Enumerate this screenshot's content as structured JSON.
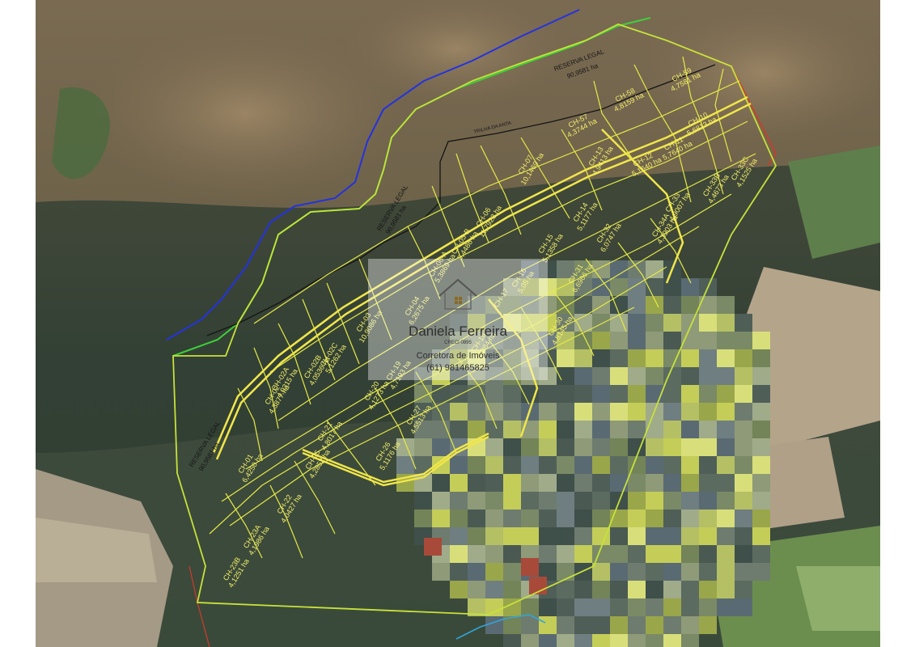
{
  "map": {
    "reserve_labels": [
      "RESERVA LEGAL",
      "90,9581 ha"
    ],
    "trail_labels": [
      "TRILHA DA ANTA"
    ],
    "lots": [
      {
        "id": "CH-59",
        "area": "4,7581 ha"
      },
      {
        "id": "CH-58",
        "area": "4,8159 ha"
      },
      {
        "id": "CH-57",
        "area": "4,3744 ha"
      },
      {
        "id": "CH-10",
        "area": "5,6813 ha"
      },
      {
        "id": "CH-11",
        "area": "5,7640 ha"
      },
      {
        "id": "CH-12",
        "area": "5,1640 ha"
      },
      {
        "id": "CH-13",
        "area": "4,9413 ha"
      },
      {
        "id": "CH-07",
        "area": "10,1469 ha"
      },
      {
        "id": "CH-06",
        "area": "11,7923 ha"
      },
      {
        "id": "CH-05-B",
        "area": "5,4486 ha"
      },
      {
        "id": "CH-06-A",
        "area": "5,3869 ha"
      },
      {
        "id": "CH-14",
        "area": "5,1177 ha"
      },
      {
        "id": "CH-15",
        "area": "5,1358 ha"
      },
      {
        "id": "CH-16",
        "area": "5,05 ha"
      },
      {
        "id": "CH-17",
        "area": ""
      },
      {
        "id": "CH-04",
        "area": "6,2675 ha"
      },
      {
        "id": "CH-03",
        "area": "10,9086 ha"
      },
      {
        "id": "CH-32",
        "area": "6,0747 ha"
      },
      {
        "id": "CH-31",
        "area": "6,6966 ha"
      },
      {
        "id": "CH-30",
        "area": "4,8145 ha"
      },
      {
        "id": "CH-33",
        "area": "4,9007 ha"
      },
      {
        "id": "CH-33B",
        "area": "4,4673 ha"
      },
      {
        "id": "CH-33C",
        "area": "4,1525 ha"
      },
      {
        "id": "CH-34A",
        "area": "4,3903 ha"
      },
      {
        "id": "CH-02",
        "area": "4,3877 ha"
      },
      {
        "id": "CH-02A",
        "area": "4,0315 ha"
      },
      {
        "id": "CH-02B",
        "area": "4,0536 ha"
      },
      {
        "id": "CH-02C",
        "area": "5,1262 ha"
      },
      {
        "id": "CH-20",
        "area": "4,1273 ha"
      },
      {
        "id": "CH-19",
        "area": "4,7193 ha"
      },
      {
        "id": "CH-18",
        "area": "4,6884 ha"
      },
      {
        "id": "CH-21",
        "area": "4,8017 ha"
      },
      {
        "id": "CH-27",
        "area": "4,5513 ha"
      },
      {
        "id": "CH-26",
        "area": "5,1176 ha"
      },
      {
        "id": "CH-25",
        "area": "4,2852 ha"
      },
      {
        "id": "CH-01",
        "area": "6,4250 ha"
      },
      {
        "id": "CH-22",
        "area": "4,0427 ha"
      },
      {
        "id": "CH-23A",
        "area": "4,1986 ha"
      },
      {
        "id": "CH-23B",
        "area": "4,1251 ha"
      }
    ]
  },
  "watermark": {
    "name": "Daniela Ferreira",
    "creci": "CRECI 0895",
    "role": "Corretora de Imóveis",
    "phone": "(61) 981465825"
  }
}
